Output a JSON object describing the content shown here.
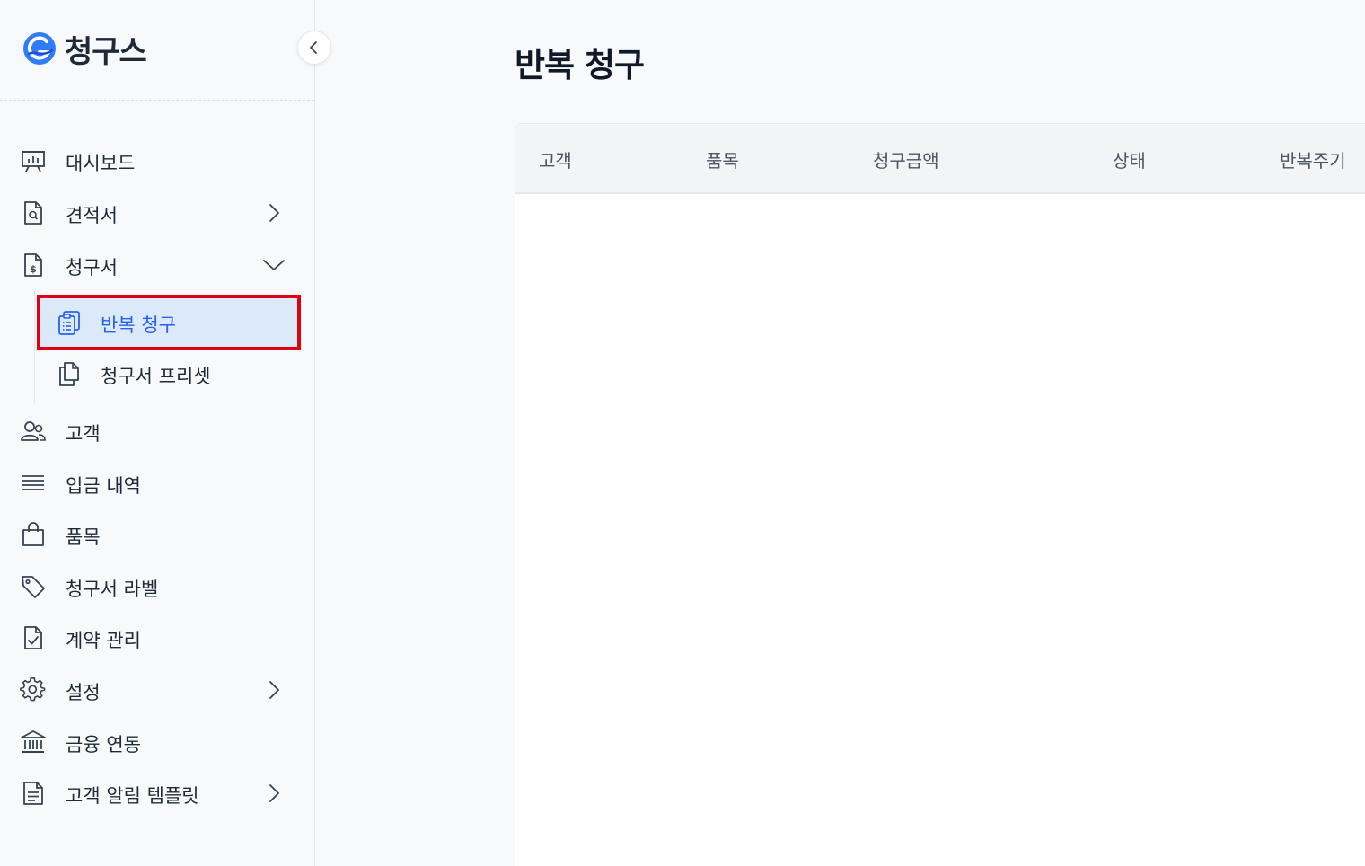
{
  "brand": {
    "name": "청구스",
    "accent": "#2563eb"
  },
  "sidebar": {
    "items": [
      {
        "label": "대시보드"
      },
      {
        "label": "견적서"
      },
      {
        "label": "청구서"
      },
      {
        "label": "고객"
      },
      {
        "label": "입금 내역"
      },
      {
        "label": "품목"
      },
      {
        "label": "청구서 라벨"
      },
      {
        "label": "계약 관리"
      },
      {
        "label": "설정"
      },
      {
        "label": "금융 연동"
      },
      {
        "label": "고객 알림 템플릿"
      }
    ],
    "sub_items": [
      {
        "label": "반복 청구",
        "active": true
      },
      {
        "label": "청구서 프리셋",
        "active": false
      }
    ]
  },
  "main": {
    "title": "반복 청구",
    "table": {
      "columns": [
        "고객",
        "품목",
        "청구금액",
        "상태",
        "반복주기"
      ],
      "rows": []
    }
  },
  "colors": {
    "active_bg": "#dce9fb",
    "active_text": "#2563eb",
    "highlight_border": "#e00012"
  }
}
